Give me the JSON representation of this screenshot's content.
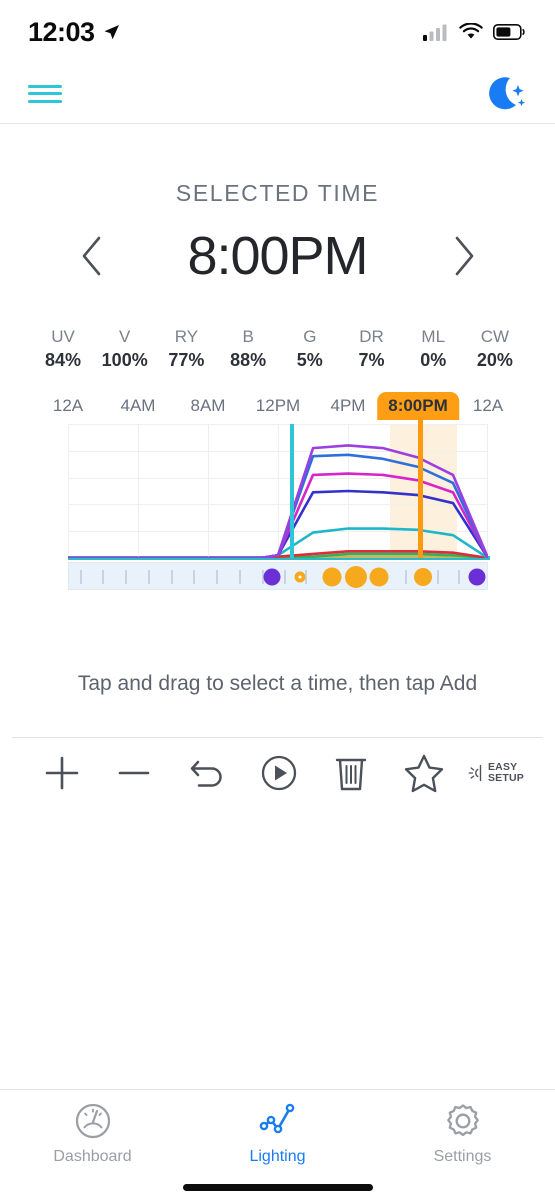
{
  "status_bar": {
    "time": "12:03",
    "location_icon": "location-arrow-icon",
    "signal_icon": "cellular-signal-icon",
    "wifi_icon": "wifi-icon",
    "battery_icon": "battery-icon"
  },
  "nav": {
    "menu_icon": "hamburger-menu-icon",
    "menu_color": "#2ec6d6",
    "night_icon": "moon-night-mode-icon",
    "night_color": "#1a7cf2"
  },
  "selected_time": {
    "label": "SELECTED TIME",
    "value": "8:00PM",
    "prev_icon": "chevron-left-icon",
    "next_icon": "chevron-right-icon"
  },
  "channels": [
    {
      "name": "UV",
      "value": "84%"
    },
    {
      "name": "V",
      "value": "100%"
    },
    {
      "name": "RY",
      "value": "77%"
    },
    {
      "name": "B",
      "value": "88%"
    },
    {
      "name": "G",
      "value": "5%"
    },
    {
      "name": "DR",
      "value": "7%"
    },
    {
      "name": "ML",
      "value": "0%"
    },
    {
      "name": "CW",
      "value": "20%"
    }
  ],
  "chart_data": {
    "type": "line",
    "title": "",
    "xlabel": "",
    "ylabel": "",
    "xlim": [
      0,
      24
    ],
    "ylim": [
      0,
      100
    ],
    "grid": true,
    "legend": "none",
    "x_tick_labels": [
      "12A",
      "4AM",
      "8AM",
      "12PM",
      "4PM",
      "8:00PM",
      "12A"
    ],
    "x_tick_hours": [
      0,
      4,
      8,
      12,
      16,
      20,
      24
    ],
    "selected_tick_index": 5,
    "selected_tick_color": "#ff9d14",
    "x": [
      0,
      11,
      12,
      14,
      16,
      18,
      20,
      22,
      24
    ],
    "series": [
      {
        "name": "UV",
        "color": "#9c3fe0",
        "values": [
          0,
          0,
          2,
          82,
          84,
          82,
          75,
          62,
          0
        ]
      },
      {
        "name": "V",
        "color": "#2f6fdb",
        "values": [
          0,
          0,
          2,
          76,
          77,
          74,
          68,
          56,
          0
        ]
      },
      {
        "name": "RY",
        "color": "#d625c8",
        "values": [
          0,
          0,
          2,
          62,
          63,
          62,
          58,
          49,
          0
        ]
      },
      {
        "name": "B",
        "color": "#3333cc",
        "values": [
          0,
          0,
          2,
          49,
          50,
          49,
          47,
          41,
          0
        ]
      },
      {
        "name": "CW",
        "color": "#1fb6c8",
        "values": [
          0,
          0,
          2,
          19,
          22,
          22,
          21,
          17,
          0
        ]
      },
      {
        "name": "DR",
        "color": "#e02b3c",
        "values": [
          0,
          0,
          1,
          3,
          5,
          5,
          5,
          4,
          0
        ]
      },
      {
        "name": "G",
        "color": "#2eb35a",
        "values": [
          0,
          0,
          0,
          1,
          3,
          3,
          3,
          2,
          0
        ]
      },
      {
        "name": "ML",
        "color": "#c8b560",
        "values": [
          0,
          0,
          0,
          1,
          1,
          1,
          1,
          1,
          0
        ]
      }
    ],
    "now_marker": {
      "hour": 12.7,
      "color": "#2ec6d6",
      "label": "current-time"
    },
    "selection_band": {
      "start_hour": 18.4,
      "end_hour": 22.2,
      "color": "#fdf0dc"
    },
    "selected_marker": {
      "hour": 20,
      "color": "#fb9a10"
    },
    "baseline_color": "#30b8c4"
  },
  "timeline_strip": {
    "background": "#e9f1fb",
    "tick_hours": [
      0.6,
      1.9,
      3.2,
      4.5,
      5.8,
      7.1,
      8.4,
      9.7,
      11.0,
      12.3,
      13.5,
      16.2,
      17.8,
      19.2,
      21.0,
      22.2,
      23.3
    ],
    "points": [
      {
        "hour": 11.6,
        "color": "#6b2fd6",
        "size": 17,
        "name": "ramp-start-point"
      },
      {
        "hour": 13.2,
        "color": "#ffffff",
        "ring": "#f7a91e",
        "size": 11,
        "name": "small-point"
      },
      {
        "hour": 15.0,
        "color": "#f7a91e",
        "size": 19,
        "name": "orange-point"
      },
      {
        "hour": 16.4,
        "color": "#f7a91e",
        "size": 22,
        "name": "orange-point"
      },
      {
        "hour": 17.7,
        "color": "#f7a91e",
        "size": 19,
        "name": "orange-point"
      },
      {
        "hour": 20.2,
        "color": "#f7a91e",
        "size": 18,
        "name": "selected-point"
      },
      {
        "hour": 23.3,
        "color": "#6b2fd6",
        "size": 17,
        "name": "ramp-end-point"
      }
    ]
  },
  "hint": {
    "text": "Tap and drag to select a time, then tap Add"
  },
  "toolbar": [
    {
      "name": "add-button",
      "icon": "plus-icon",
      "label": ""
    },
    {
      "name": "remove-button",
      "icon": "minus-icon",
      "label": ""
    },
    {
      "name": "undo-button",
      "icon": "undo-arrow-icon",
      "label": ""
    },
    {
      "name": "play-button",
      "icon": "play-circle-icon",
      "label": ""
    },
    {
      "name": "delete-button",
      "icon": "trash-icon",
      "label": ""
    },
    {
      "name": "favorite-button",
      "icon": "star-icon",
      "label": ""
    },
    {
      "name": "easy-setup-button",
      "icon": "brightness-icon",
      "label_line1": "EASY",
      "label_line2": "SETUP"
    }
  ],
  "tabs": [
    {
      "label": "Dashboard",
      "icon": "gauge-icon",
      "active": false
    },
    {
      "label": "Lighting",
      "icon": "line-chart-icon",
      "active": true
    },
    {
      "label": "Settings",
      "icon": "gear-icon",
      "active": false
    }
  ],
  "colors": {
    "accent": "#1a7cf2",
    "teal": "#2ec6d6",
    "orange": "#ff9d14"
  }
}
